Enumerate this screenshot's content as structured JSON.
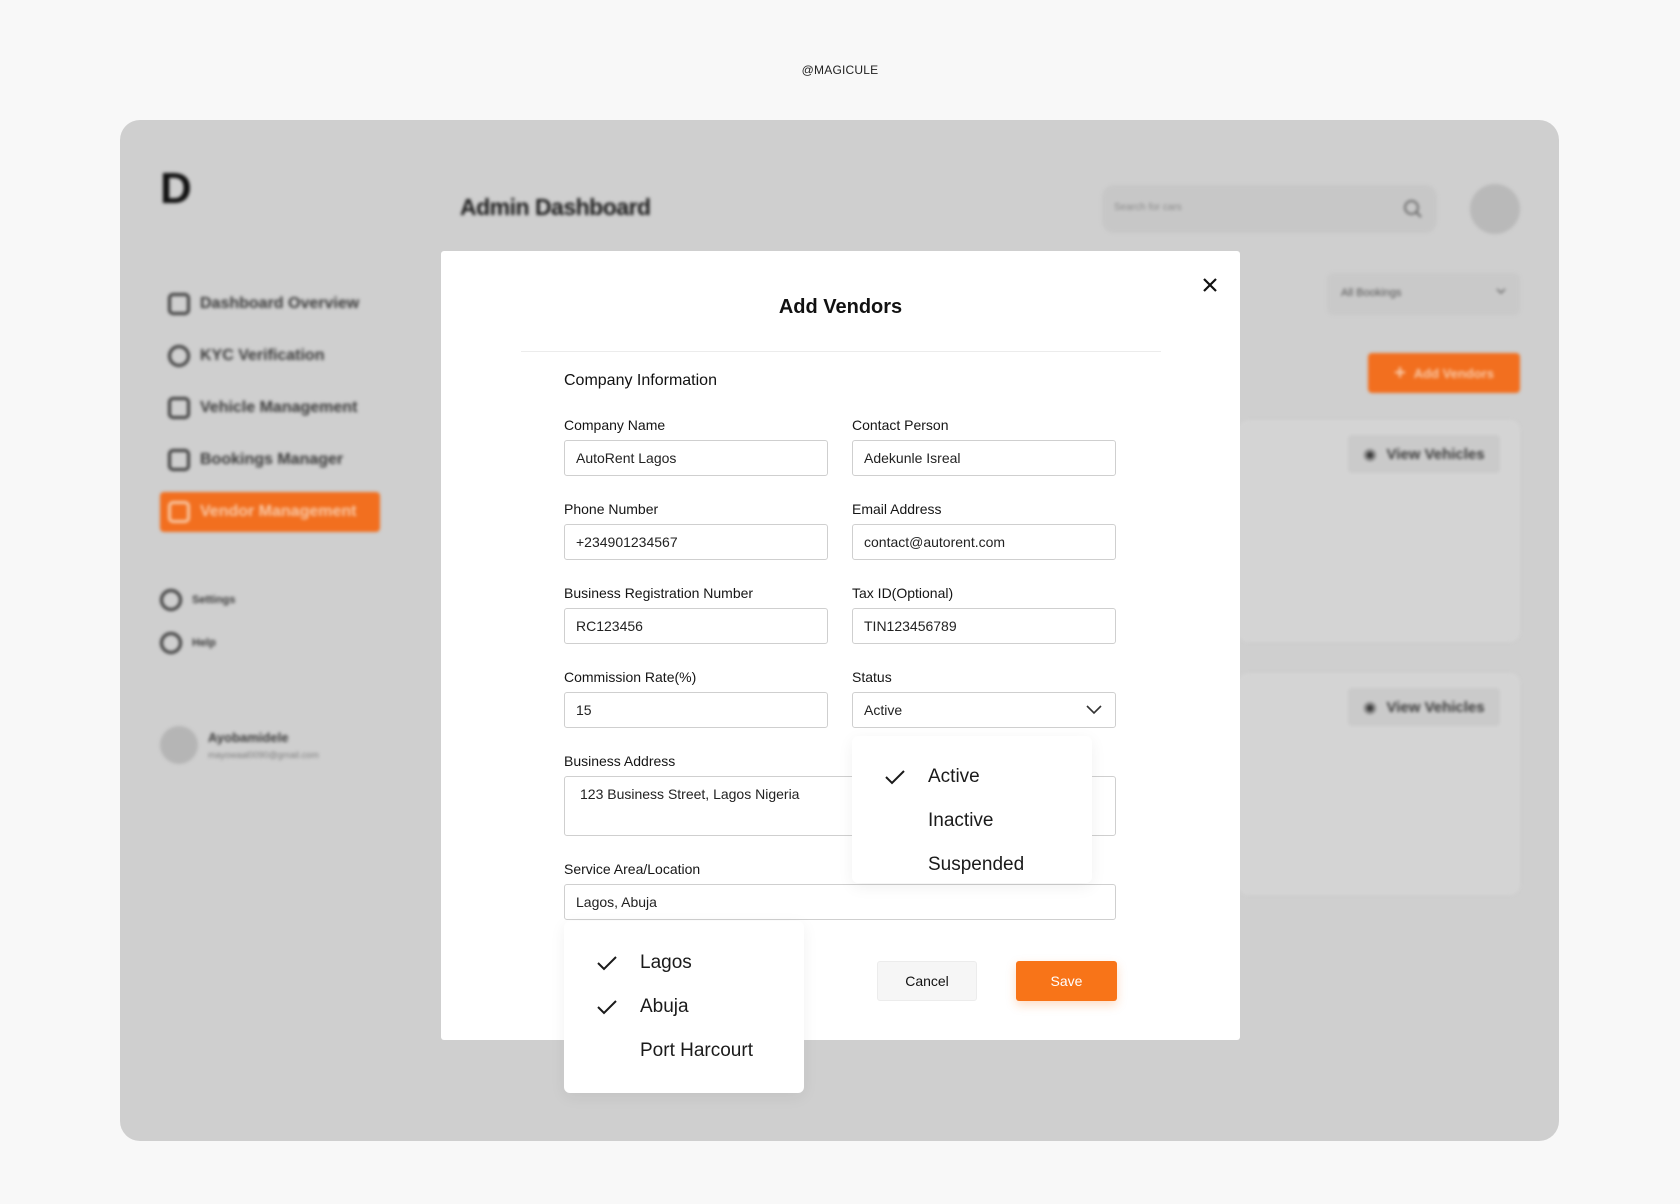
{
  "credit": "@MAGICULE",
  "app": {
    "logo": "D",
    "page_title": "Admin Dashboard",
    "search_placeholder": "Search for cars",
    "sidebar": {
      "items": [
        {
          "label": "Dashboard Overview",
          "icon": "grid-icon"
        },
        {
          "label": "KYC Verification",
          "icon": "user-icon"
        },
        {
          "label": "Vehicle Management",
          "icon": "car-icon"
        },
        {
          "label": "Bookings Manager",
          "icon": "calendar-icon"
        },
        {
          "label": "Vendor Management",
          "icon": "building-icon",
          "active": true
        }
      ],
      "secondary": [
        {
          "label": "Settings",
          "icon": "gear-icon"
        },
        {
          "label": "Help",
          "icon": "help-icon"
        }
      ],
      "user": {
        "name": "Ayobamidele",
        "email": "mayowaal0090@gmail.com"
      }
    },
    "filter_label": "All Bookings",
    "add_vendors_label": "Add Vendors",
    "view_vehicles_label": "View Vehicles",
    "accent_color": "#f87418"
  },
  "modal": {
    "title": "Add Vendors",
    "section": "Company Information",
    "fields": {
      "company_name": {
        "label": "Company Name",
        "value": "AutoRent Lagos"
      },
      "contact_person": {
        "label": "Contact Person",
        "value": "Adekunle Isreal"
      },
      "phone": {
        "label": "Phone Number",
        "value": "+234901234567"
      },
      "email": {
        "label": "Email Address",
        "value": "contact@autorent.com"
      },
      "reg_number": {
        "label": "Business Registration Number",
        "value": "RC123456"
      },
      "tax_id": {
        "label": "Tax ID(Optional)",
        "value": "TIN123456789"
      },
      "commission": {
        "label": "Commission Rate(%)",
        "value": "15"
      },
      "status": {
        "label": "Status",
        "value": "Active"
      },
      "address": {
        "label": "Business Address",
        "value": "123 Business Street, Lagos Nigeria"
      },
      "service_area": {
        "label": "Service Area/Location",
        "value": "Lagos, Abuja"
      }
    },
    "status_options": [
      {
        "label": "Active",
        "checked": true
      },
      {
        "label": "Inactive",
        "checked": false
      },
      {
        "label": "Suspended",
        "checked": false
      }
    ],
    "location_options": [
      {
        "label": "Lagos",
        "checked": true
      },
      {
        "label": "Abuja",
        "checked": true
      },
      {
        "label": "Port Harcourt",
        "checked": false
      }
    ],
    "cancel_label": "Cancel",
    "save_label": "Save"
  }
}
